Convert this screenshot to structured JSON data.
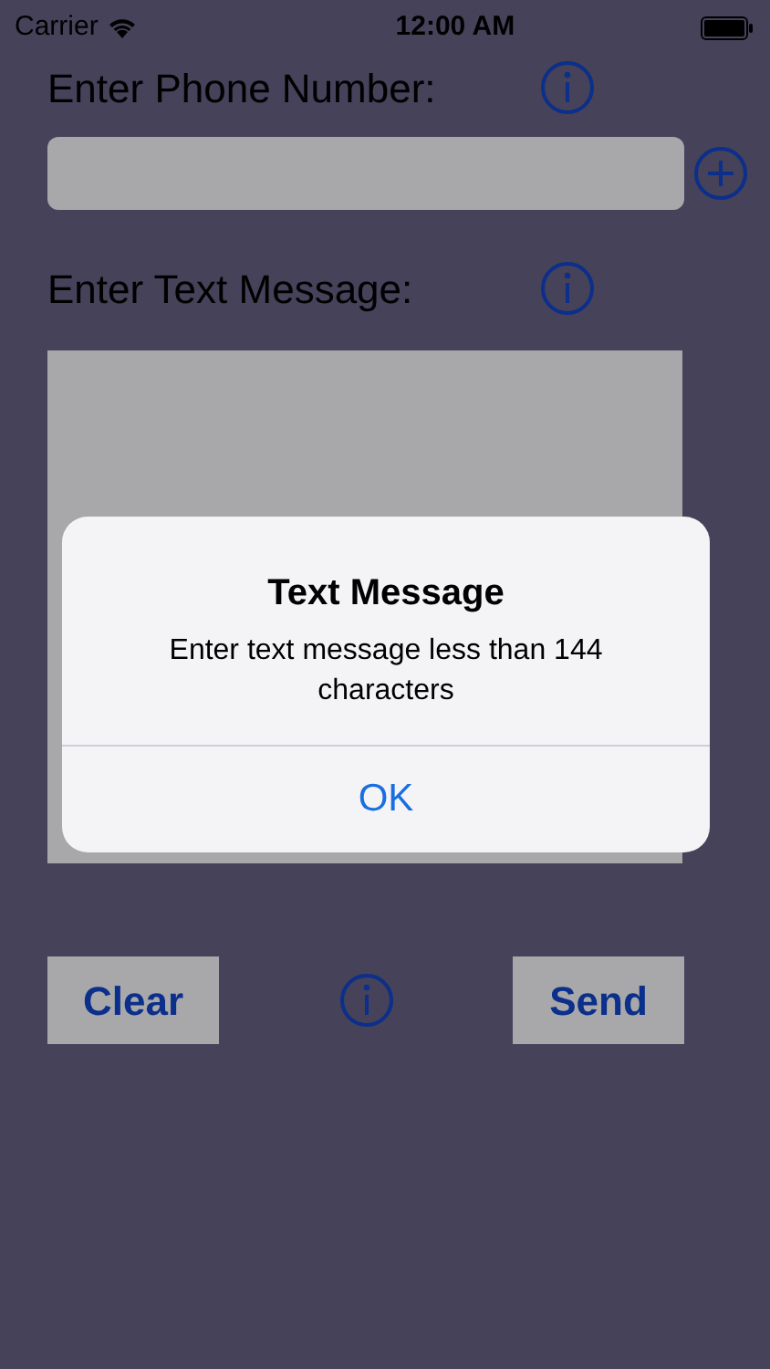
{
  "status_bar": {
    "carrier": "Carrier",
    "time": "12:00 AM"
  },
  "phone_section": {
    "label": "Enter Phone Number:"
  },
  "message_section": {
    "label": "Enter Text Message:"
  },
  "buttons": [
    {
      "label": "Clear"
    },
    {
      "label": "Send"
    }
  ],
  "alert": {
    "title": "Text Message",
    "message": "Enter text message less than 144 characters",
    "button": "OK"
  }
}
